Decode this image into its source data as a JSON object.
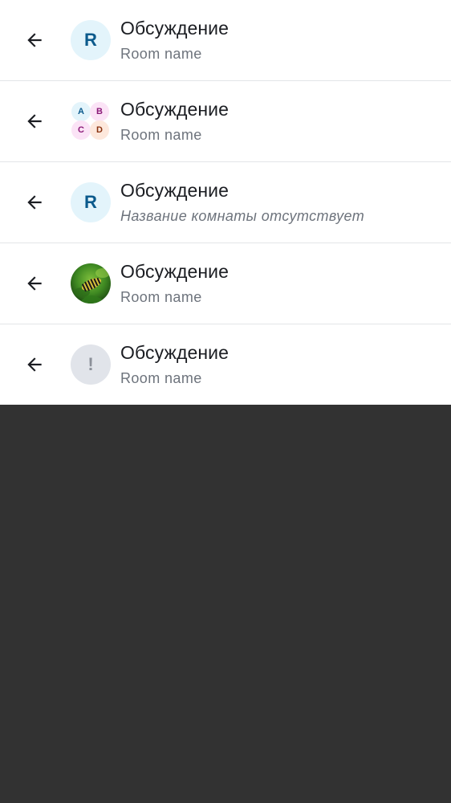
{
  "colors": {
    "background": "#323232",
    "panel": "#ffffff",
    "divider": "#e3e5e8",
    "title": "#1b1d22",
    "subtitle": "#6d737c",
    "avatar_letter_bg": "#e3f4fb",
    "avatar_letter_fg": "#0b5a8c"
  },
  "rows": [
    {
      "icon": "back-arrow-icon",
      "avatar": {
        "type": "letter",
        "letter": "R"
      },
      "title": "Обсуждение",
      "subtitle": "Room name"
    },
    {
      "icon": "back-arrow-icon",
      "avatar": {
        "type": "cluster",
        "letters": [
          "A",
          "B",
          "C",
          "D"
        ]
      },
      "title": "Обсуждение",
      "subtitle": "Room name"
    },
    {
      "icon": "back-arrow-icon",
      "avatar": {
        "type": "letter",
        "letter": "R"
      },
      "title": "Обсуждение",
      "subtitle": "Название комнаты отсутствует"
    },
    {
      "icon": "back-arrow-icon",
      "avatar": {
        "type": "image",
        "image": "caterpillar-photo"
      },
      "title": "Обсуждение",
      "subtitle": "Room name"
    },
    {
      "icon": "back-arrow-icon",
      "avatar": {
        "type": "unknown",
        "letter": "!"
      },
      "title": "Обсуждение",
      "subtitle": "Room name"
    }
  ]
}
